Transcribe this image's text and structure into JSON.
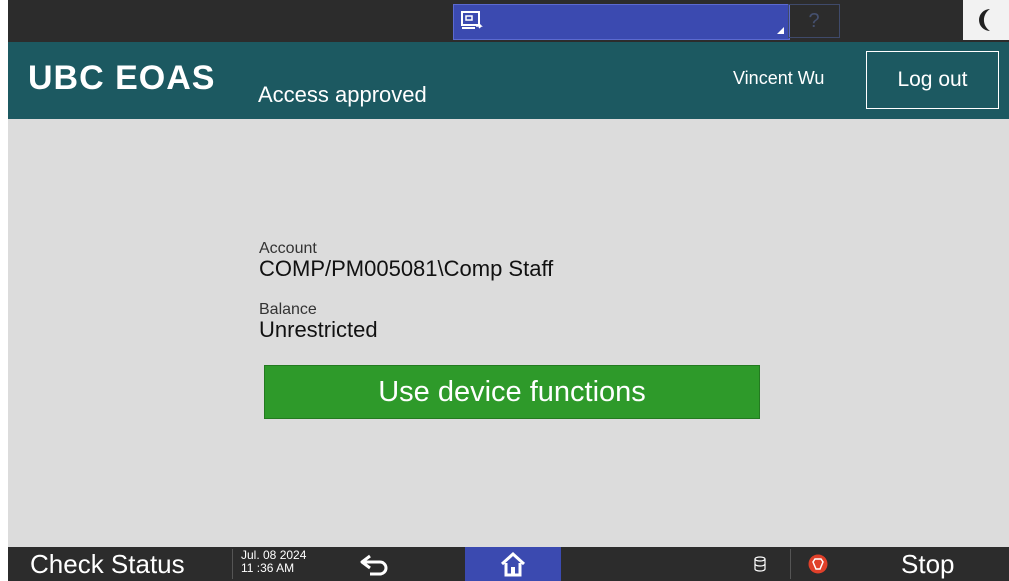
{
  "system_bar": {
    "help_label": "?"
  },
  "header": {
    "brand": "UBC EOAS",
    "status": "Access approved",
    "user_name": "Vincent Wu",
    "logout_label": "Log out"
  },
  "main": {
    "account_label": "Account",
    "account_value": "COMP/PM005081\\Comp Staff",
    "balance_label": "Balance",
    "balance_value": "Unrestricted",
    "action_label": "Use device functions"
  },
  "bottom_bar": {
    "check_status_label": "Check Status",
    "date": "Jul. 08 2024",
    "time": "11 :36 AM",
    "stop_label": "Stop"
  },
  "colors": {
    "header": "#1c5961",
    "action_button": "#2e9a2a",
    "accent_blue": "#3b4ab0",
    "stop_red": "#e0402a"
  }
}
